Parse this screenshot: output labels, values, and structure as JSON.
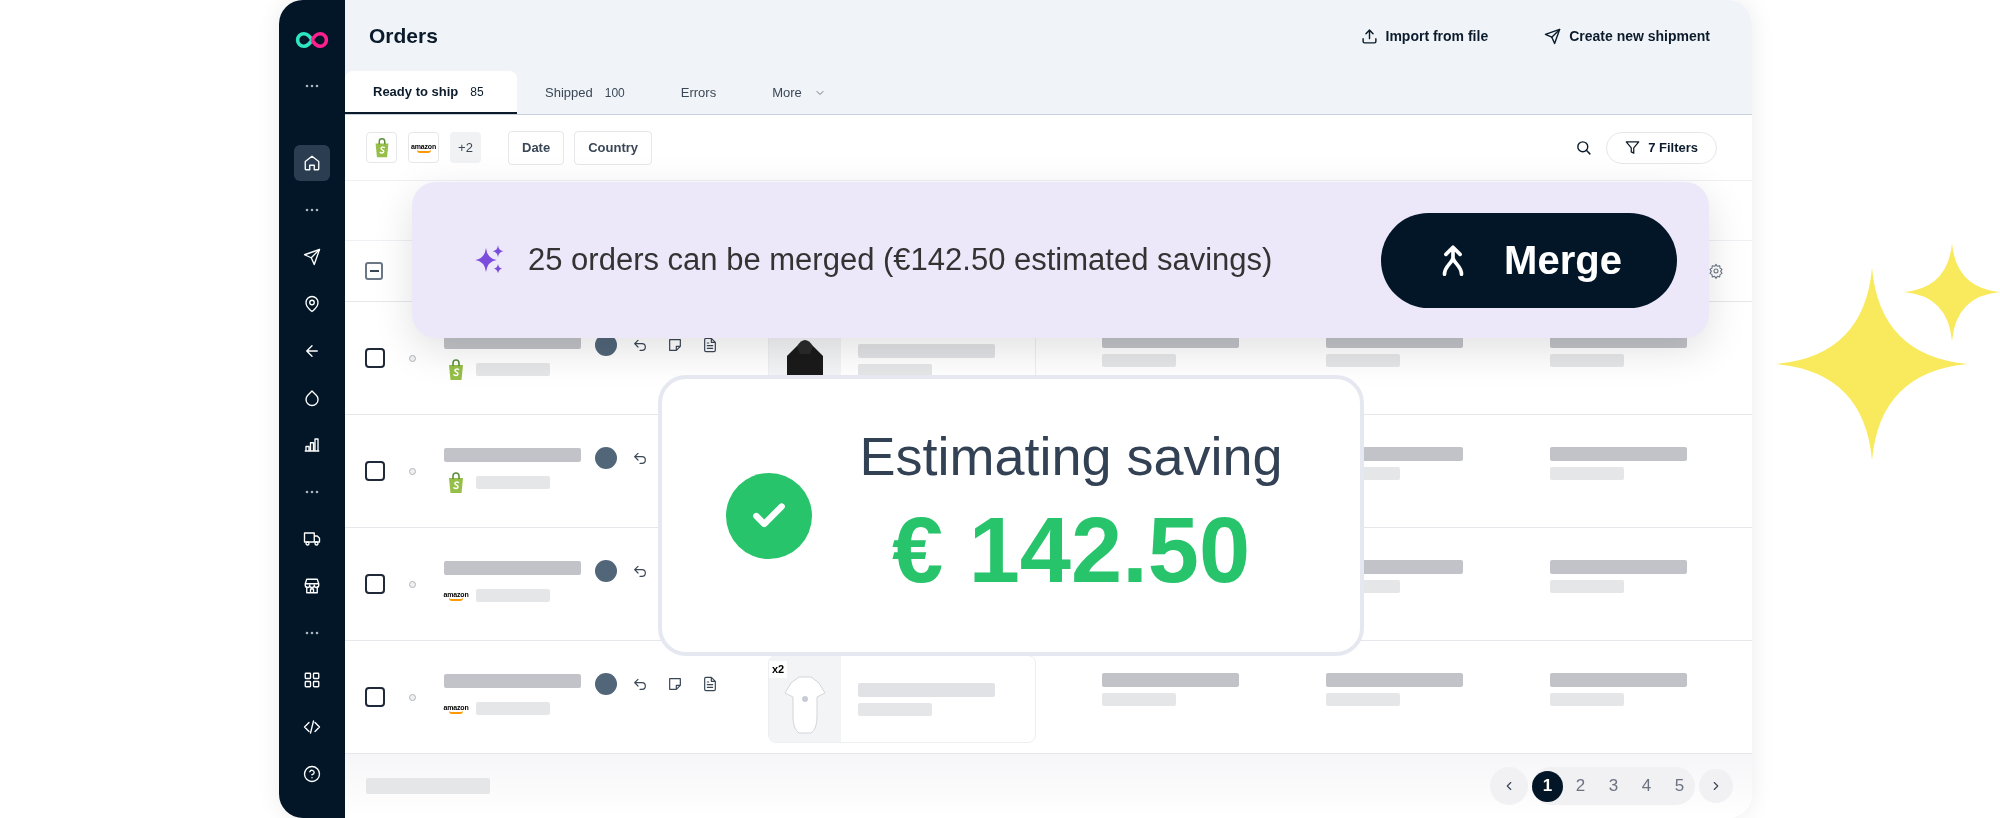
{
  "sidebar": {
    "groups": [
      [
        {
          "selected": true
        }
      ],
      [
        {
          "selected": false
        },
        {
          "selected": false
        },
        {
          "selected": false
        },
        {
          "selected": false
        },
        {
          "selected": false
        }
      ],
      [
        {
          "selected": false
        },
        {
          "selected": false
        }
      ],
      [
        {
          "selected": false
        },
        {
          "selected": false
        },
        {
          "selected": false
        }
      ]
    ]
  },
  "header": {
    "title": "Orders",
    "actions": [
      {
        "kind": "import",
        "label": "Import from file"
      },
      {
        "kind": "shipment",
        "label": "Create new shipment"
      }
    ]
  },
  "tabs": [
    {
      "kind": "tab",
      "label": "Ready to ship",
      "count": "85",
      "selected": true
    },
    {
      "kind": "tab",
      "label": "Shipped",
      "count": "100",
      "selected": false
    },
    {
      "kind": "tab",
      "label": "Errors",
      "selected": false
    },
    {
      "kind": "menu",
      "label": "More",
      "selected": false
    }
  ],
  "store_filters": [
    {
      "kind": "shopify"
    },
    {
      "kind": "amazon",
      "label": "amazon"
    },
    {
      "kind": "more",
      "label": "+2"
    }
  ],
  "filter_buttons": [
    "Date",
    "Country"
  ],
  "filters_button": "7 Filters",
  "table": {
    "select_all": {
      "indeterminate": true
    },
    "rows": [
      {
        "checked": false,
        "source": {
          "kind": "shopify"
        }
      },
      {
        "checked": false,
        "source": {
          "kind": "shopify"
        }
      },
      {
        "checked": false,
        "source": {
          "kind": "amazon",
          "label": "amazon"
        }
      },
      {
        "checked": false,
        "source": {
          "kind": "amazon",
          "label": "amazon"
        },
        "product": {
          "kind": "picture",
          "badge": "x2"
        }
      }
    ]
  },
  "pagination": {
    "pages": [
      {
        "label": "1",
        "selected": true
      },
      {
        "label": "2",
        "selected": false
      },
      {
        "label": "3",
        "selected": false
      },
      {
        "label": "4",
        "selected": false
      },
      {
        "label": "5",
        "selected": false
      }
    ]
  },
  "merge_banner": {
    "message": "25 orders can be merged (€142.50 estimated savings)",
    "button": "Merge"
  },
  "savings_card": {
    "title": "Estimating saving",
    "amount": "€ 142.50"
  }
}
